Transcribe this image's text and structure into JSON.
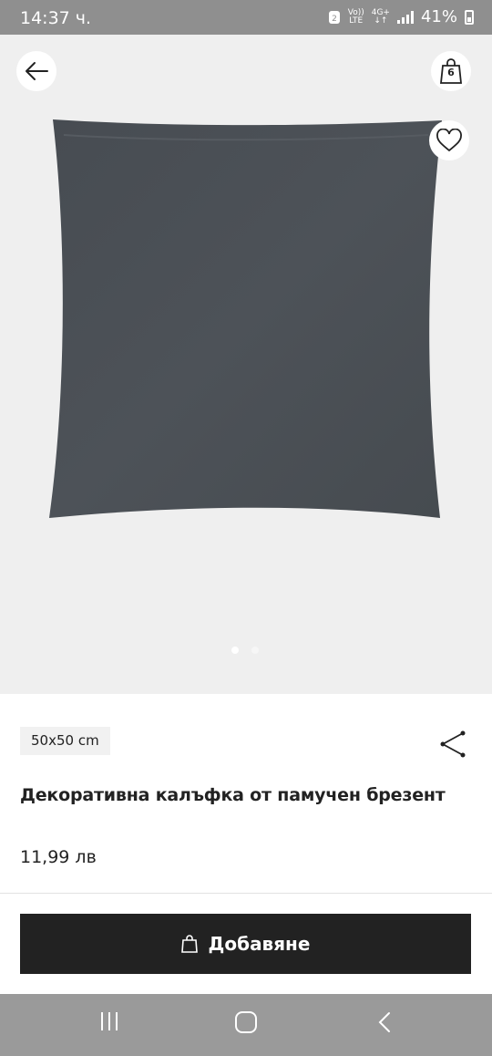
{
  "status_bar": {
    "time": "14:37 ч.",
    "network_top": "Vo))",
    "network_bottom": "LTE",
    "network_type": "4G+",
    "battery": "41%"
  },
  "header": {
    "back_icon": "arrow-left-icon",
    "bag_icon": "shopping-bag-icon",
    "bag_count": "6"
  },
  "gallery": {
    "wishlist_icon": "heart-icon",
    "image_description_icon": "pillow-image",
    "page_count": 2,
    "active_page": 1
  },
  "product": {
    "size": "50x50 cm",
    "title": "Декоративна калъфка от памучен брезент",
    "price": "11,99 лв"
  },
  "actions": {
    "add_label": "Добавяне",
    "share_icon": "share-icon"
  },
  "nav": {
    "recent_icon": "recent-apps-icon",
    "home_icon": "home-icon",
    "back_icon": "back-icon"
  },
  "colors": {
    "pillow": "#4a4f54",
    "button": "#222222",
    "background": "#efefef"
  }
}
